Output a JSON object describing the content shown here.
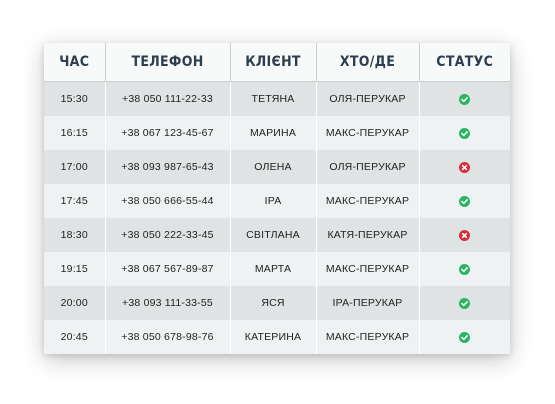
{
  "table": {
    "headers": {
      "time": "ЧАС",
      "phone": "ТЕЛЕФОН",
      "client": "КЛІЄНТ",
      "who": "ХТО/ДЕ",
      "status": "СТАТУС"
    },
    "rows": [
      {
        "time": "15:30",
        "phone": "+38 050 111-22-33",
        "client": "ТЕТЯНА",
        "who": "ОЛЯ-ПЕРУКАР",
        "status": "ok"
      },
      {
        "time": "16:15",
        "phone": "+38 067 123-45-67",
        "client": "МАРИНА",
        "who": "МАКС-ПЕРУКАР",
        "status": "ok"
      },
      {
        "time": "17:00",
        "phone": "+38 093 987-65-43",
        "client": "ОЛЕНА",
        "who": "ОЛЯ-ПЕРУКАР",
        "status": "cancel"
      },
      {
        "time": "17:45",
        "phone": "+38 050 666-55-44",
        "client": "ІРА",
        "who": "МАКС-ПЕРУКАР",
        "status": "ok"
      },
      {
        "time": "18:30",
        "phone": "+38 050 222-33-45",
        "client": "СВІТЛАНА",
        "who": "КАТЯ-ПЕРУКАР",
        "status": "cancel"
      },
      {
        "time": "19:15",
        "phone": "+38 067 567-89-87",
        "client": "МАРТА",
        "who": "МАКС-ПЕРУКАР",
        "status": "ok"
      },
      {
        "time": "20:00",
        "phone": "+38 093 111-33-55",
        "client": "ЯСЯ",
        "who": "ІРА-ПЕРУКАР",
        "status": "ok"
      },
      {
        "time": "20:45",
        "phone": "+38 050 678-98-76",
        "client": "КАТЕРИНА",
        "who": "МАКС-ПЕРУКАР",
        "status": "ok"
      }
    ]
  },
  "icons": {
    "ok": "check-circle-icon",
    "cancel": "x-circle-icon"
  },
  "colors": {
    "ok": "#2ab566",
    "cancel": "#d6303a",
    "header_text": "#2c3e50"
  }
}
